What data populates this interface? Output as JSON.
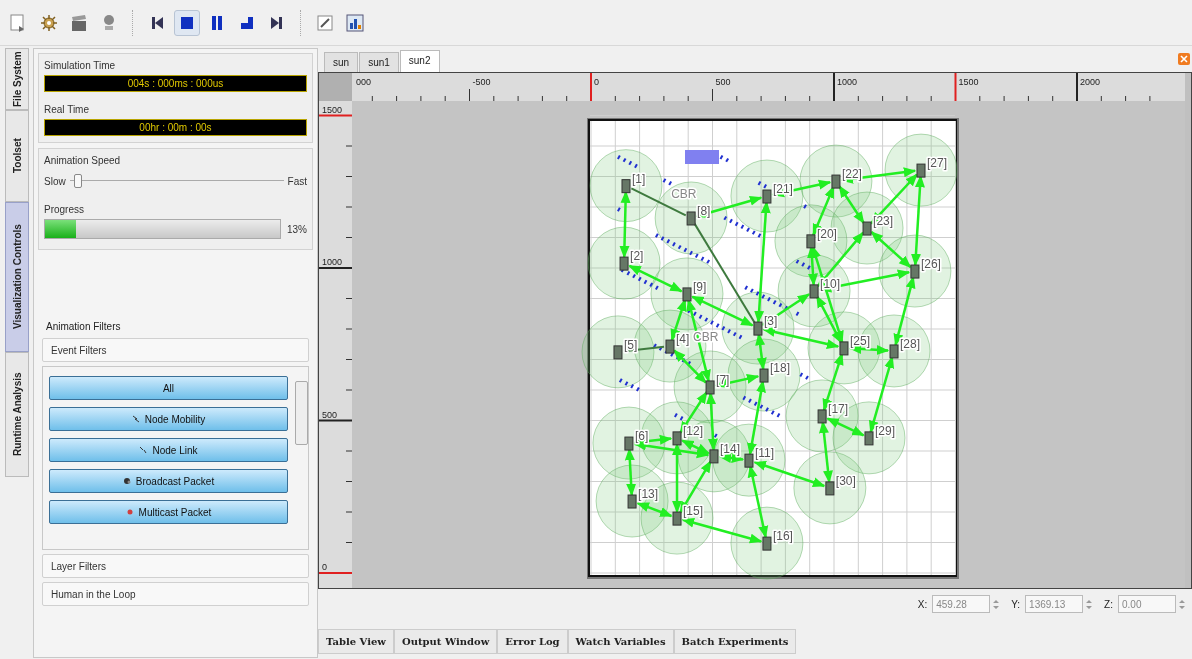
{
  "toolbar": {
    "tools": [
      {
        "kind": "new"
      },
      {
        "kind": "settings"
      },
      {
        "kind": "clapper"
      },
      {
        "kind": "record"
      }
    ],
    "playback": [
      {
        "kind": "first",
        "selected": false
      },
      {
        "kind": "stop",
        "selected": true
      },
      {
        "kind": "pause",
        "selected": false
      },
      {
        "kind": "step",
        "selected": false
      },
      {
        "kind": "last",
        "selected": false
      }
    ],
    "extras": [
      {
        "kind": "edit"
      },
      {
        "kind": "chart"
      }
    ]
  },
  "side_tabs": [
    {
      "label": "File System",
      "selected": false
    },
    {
      "label": "Toolset",
      "selected": false
    },
    {
      "label": "Visualization Controls",
      "selected": true
    },
    {
      "label": "Runtime Analysis",
      "selected": false
    }
  ],
  "time": {
    "simulation_label": "Simulation Time",
    "simulation_value": "004s : 000ms : 000us",
    "real_label": "Real Time",
    "real_value": "00hr : 00m : 00s"
  },
  "speed": {
    "label": "Animation Speed",
    "min_label": "Slow",
    "max_label": "Fast",
    "level": 0.02
  },
  "progress": {
    "label": "Progress",
    "level": 0.13,
    "reading": "13%"
  },
  "filters": {
    "label": "Animation Filters",
    "event_header": "Event Filters",
    "events": [
      {
        "label": "All",
        "kind": "all"
      },
      {
        "label": "Node Mobility",
        "kind": "mobility"
      },
      {
        "label": "Node Link",
        "kind": "link"
      },
      {
        "label": "Broadcast Packet",
        "kind": "broadcast"
      },
      {
        "label": "Multicast Packet",
        "kind": "multicast"
      }
    ],
    "sections": [
      "Layer Filters",
      "Human in the Loop"
    ]
  },
  "doc_tabs": [
    {
      "label": "sun",
      "selected": false
    },
    {
      "label": "sun1",
      "selected": false
    },
    {
      "label": "sun2",
      "selected": true
    }
  ],
  "canvas": {
    "x_ruler": [
      "000",
      "-500",
      "0",
      "500",
      "1000",
      "1500",
      "2000"
    ],
    "y_ruler": [
      "1500",
      "1000",
      "500",
      "0"
    ],
    "nodes": [
      "[27]",
      "[22]",
      "[1]",
      "[21]",
      "[8]",
      "[23]",
      "[20]",
      "[2]",
      "[26]",
      "[9]",
      "[10]",
      "[3]",
      "[5]",
      "[4]",
      "[25]",
      "[28]",
      "[18]",
      "[7]",
      "[17]",
      "[6]",
      "[12]",
      "[29]",
      "[14]",
      "[11]",
      "[30]",
      "[13]",
      "[15]",
      "[16]"
    ],
    "flow_labels": [
      "CBR",
      "CBR"
    ]
  },
  "coordinates": [
    {
      "label": "X:",
      "value": "459.28"
    },
    {
      "label": "Y:",
      "value": "1369.13"
    },
    {
      "label": "Z:",
      "value": "0.00"
    }
  ],
  "bottom_tabs": [
    "Table View",
    "Output Window",
    "Error Log",
    "Watch Variables",
    "Batch Experiments"
  ]
}
